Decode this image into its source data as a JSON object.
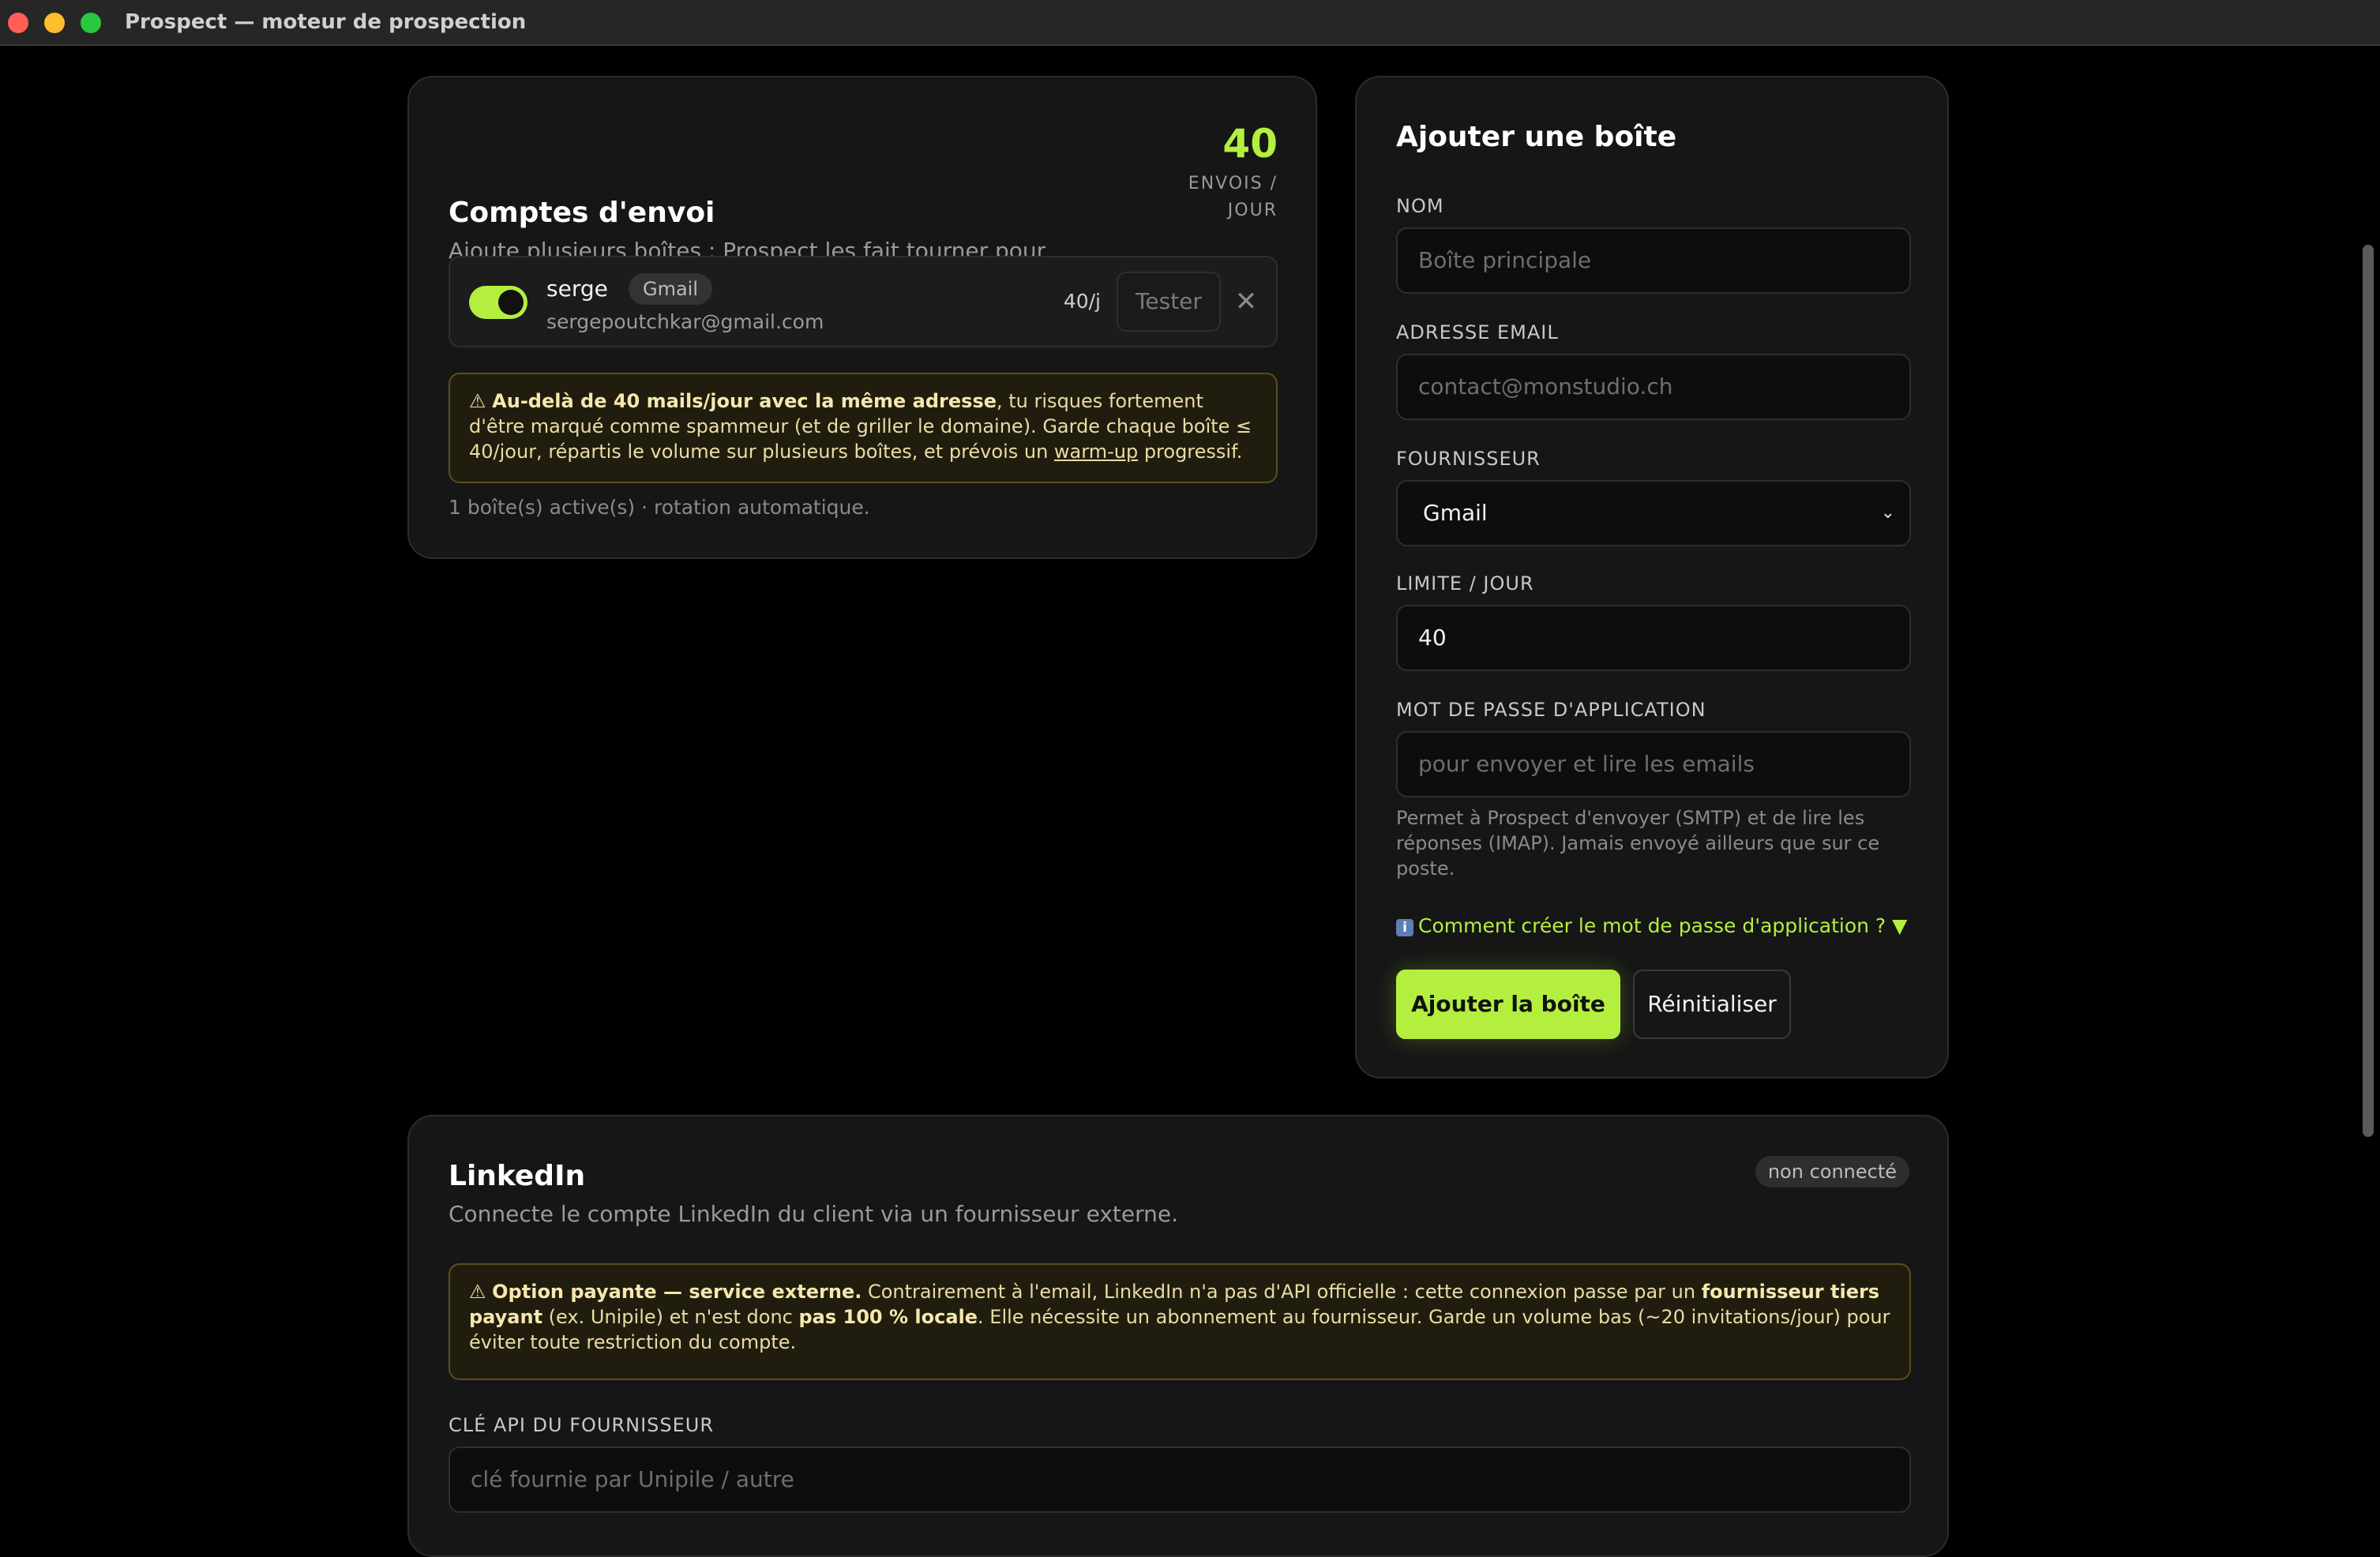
{
  "window": {
    "title": "Prospect — moteur de prospection"
  },
  "accounts": {
    "title": "Comptes d'envoi",
    "subtitle": "Ajoute plusieurs boîtes : Prospect les fait tourner pour limiter le spam.",
    "stat_value": "40",
    "stat_unit": "ENVOIS / JOUR",
    "list": [
      {
        "name": "serge",
        "provider": "Gmail",
        "email": "sergepoutchkar@gmail.com",
        "limit": "40/j",
        "enabled": true,
        "test_label": "Tester",
        "remove_icon": "close-icon"
      }
    ],
    "warning": {
      "icon": "⚠",
      "bold": "Au-delà de 40 mails/jour avec la même adresse",
      "text1": ", tu risques fortement d'être marqué comme spammeur (et de griller le domaine). Garde chaque boîte ≤ 40/jour, répartis le volume sur plusieurs boîtes, et prévois un ",
      "link": "warm-up",
      "text2": " progressif."
    },
    "rotation_note": "1 boîte(s) active(s) · rotation automatique."
  },
  "add_box": {
    "title": "Ajouter une boîte",
    "name_label": "NOM",
    "name_placeholder": "Boîte principale",
    "email_label": "ADRESSE EMAIL",
    "email_placeholder": "contact@monstudio.ch",
    "provider_label": "FOURNISSEUR",
    "provider_value": "Gmail",
    "limit_label": "LIMITE / JOUR",
    "limit_value": "40",
    "password_label": "MOT DE PASSE D'APPLICATION",
    "password_placeholder": "pour envoyer et lire les emails",
    "password_help": "Permet à Prospect d'envoyer (SMTP) et de lire les réponses (IMAP). Jamais envoyé ailleurs que sur ce poste.",
    "howto_icon": "i",
    "howto_link": "Comment créer le mot de passe d'application ? ▼",
    "submit_label": "Ajouter la boîte",
    "reset_label": "Réinitialiser"
  },
  "linkedin": {
    "title": "LinkedIn",
    "subtitle": "Connecte le compte LinkedIn du client via un fournisseur externe.",
    "status": "non connecté",
    "warning": {
      "icon": "⚠",
      "bold1": "Option payante — service externe.",
      "text1": " Contrairement à l'email, LinkedIn n'a pas d'API officielle : cette connexion passe par un ",
      "bold2": "fournisseur tiers payant",
      "text2": " (ex. Unipile) et n'est donc ",
      "bold3": "pas 100 % locale",
      "text3": ". Elle nécessite un abonnement au fournisseur. Garde un volume bas (~20 invitations/jour) pour éviter toute restriction du compte."
    },
    "api_label": "CLÉ API DU FOURNISSEUR",
    "api_placeholder": "clé fournie par Unipile / autre"
  },
  "colors": {
    "accent": "#b4ef3f",
    "background": "#000000",
    "card": "#161616",
    "warning_bg": "#211d0e",
    "warning_border": "#5a4e1c"
  }
}
